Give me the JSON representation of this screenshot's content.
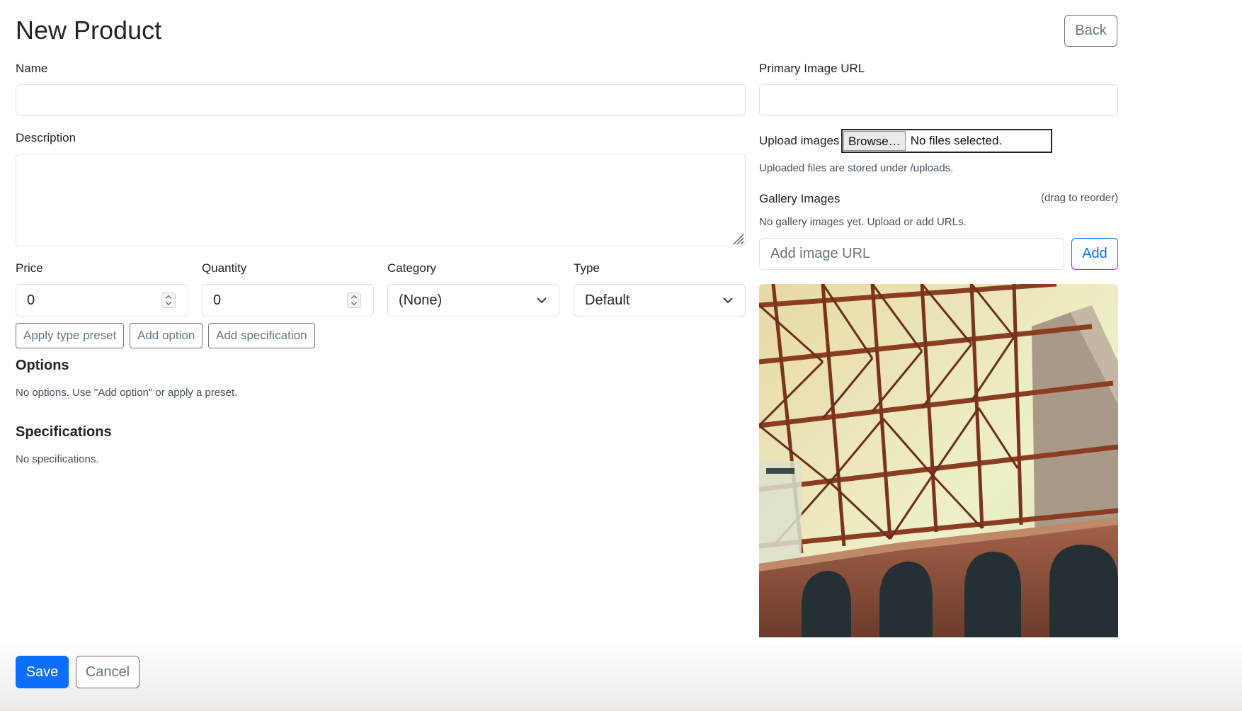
{
  "page": {
    "title": "New Product",
    "back_label": "Back"
  },
  "form": {
    "name_label": "Name",
    "name_value": "",
    "description_label": "Description",
    "description_value": "",
    "price_label": "Price",
    "price_value": "0",
    "quantity_label": "Quantity",
    "quantity_value": "0",
    "category_label": "Category",
    "category_value": "(None)",
    "type_label": "Type",
    "type_value": "Default",
    "apply_preset_label": "Apply type preset",
    "add_option_label": "Add option",
    "add_specification_label": "Add specification",
    "options_heading": "Options",
    "options_empty": "No options. Use \"Add option\" or apply a preset.",
    "specs_heading": "Specifications",
    "specs_empty": "No specifications."
  },
  "images": {
    "primary_label": "Primary Image URL",
    "primary_value": "",
    "upload_label": "Upload images",
    "browse_label": "Browse…",
    "file_status": "No files selected.",
    "upload_hint": "Uploaded files are stored under /uploads.",
    "gallery_label": "Gallery Images",
    "gallery_hint": "(drag to reorder)",
    "gallery_empty": "No gallery images yet. Upload or add URLs.",
    "add_url_placeholder": "Add image URL",
    "add_label": "Add",
    "preview_icon": "bridge-photo"
  },
  "footer": {
    "save_label": "Save",
    "cancel_label": "Cancel"
  },
  "colors": {
    "primary": "#0d6efd",
    "secondary": "#6c757d",
    "border": "#dee2e6"
  }
}
